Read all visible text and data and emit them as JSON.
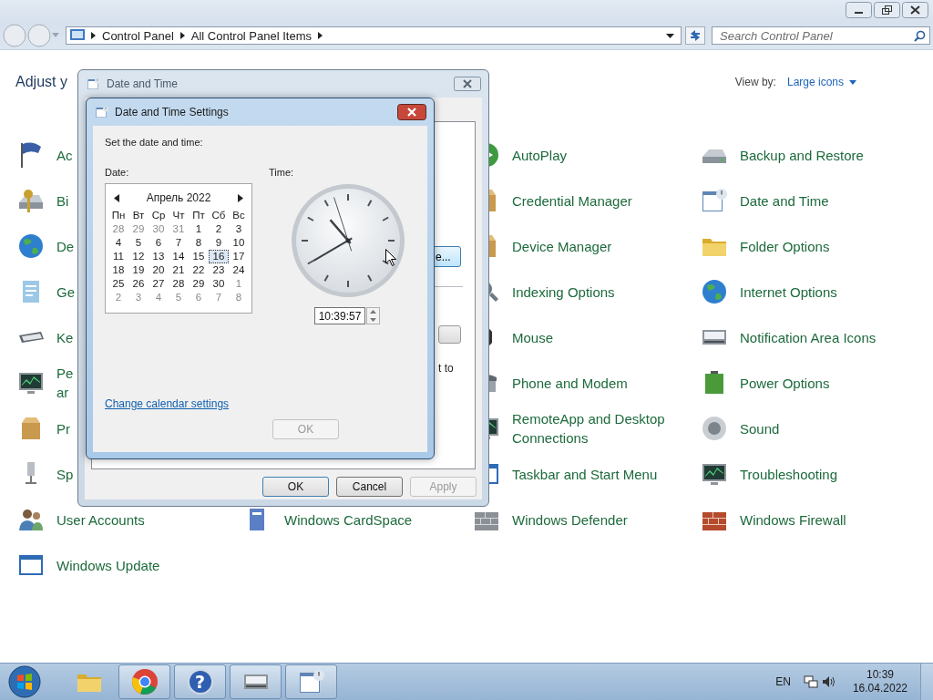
{
  "address_bar": {
    "crumbs": [
      "Control Panel",
      "All Control Panel Items"
    ]
  },
  "search": {
    "placeholder": "Search Control Panel"
  },
  "content": {
    "heading": "Adjust y",
    "view_by_label": "View by:",
    "view_by_value": "Large icons",
    "rows": [
      {
        "items": [
          {
            "kind": "item",
            "label": "Ac"
          },
          {
            "kind": "covered"
          },
          {
            "kind": "item",
            "label": "AutoPlay"
          },
          {
            "kind": "item",
            "label": "Backup and Restore"
          }
        ]
      },
      {
        "items": [
          {
            "kind": "item",
            "label": "Bi"
          },
          {
            "kind": "covered"
          },
          {
            "kind": "item",
            "label": "Credential Manager"
          },
          {
            "kind": "item",
            "label": "Date and Time"
          }
        ]
      },
      {
        "items": [
          {
            "kind": "item",
            "label": "De"
          },
          {
            "kind": "covered"
          },
          {
            "kind": "item",
            "label": "Device Manager"
          },
          {
            "kind": "item",
            "label": "Folder Options"
          }
        ]
      },
      {
        "items": [
          {
            "kind": "item",
            "label": "Ge"
          },
          {
            "kind": "covered"
          },
          {
            "kind": "item",
            "label": "Indexing Options"
          },
          {
            "kind": "item",
            "label": "Internet Options"
          }
        ]
      },
      {
        "items": [
          {
            "kind": "item",
            "label": "Ke"
          },
          {
            "kind": "covered"
          },
          {
            "kind": "item",
            "label": "Mouse"
          },
          {
            "kind": "item",
            "label": "Notification Area Icons"
          }
        ]
      },
      {
        "items": [
          {
            "kind": "item",
            "lines": [
              "Pe",
              "ar"
            ]
          },
          {
            "kind": "covered"
          },
          {
            "kind": "item",
            "label": "Phone and Modem"
          },
          {
            "kind": "item",
            "label": "Power Options"
          }
        ]
      },
      {
        "items": [
          {
            "kind": "item",
            "label": "Pr"
          },
          {
            "kind": "covered"
          },
          {
            "kind": "item",
            "label": "RemoteApp and Desktop Connections"
          },
          {
            "kind": "item",
            "label": "Sound"
          }
        ]
      },
      {
        "items": [
          {
            "kind": "item",
            "label": "Sp"
          },
          {
            "kind": "covered"
          },
          {
            "kind": "item",
            "label": "Taskbar and Start Menu"
          },
          {
            "kind": "item",
            "label": "Troubleshooting"
          }
        ]
      },
      {
        "items": [
          {
            "kind": "item",
            "label": "User Accounts"
          },
          {
            "kind": "item",
            "label": "Windows CardSpace"
          },
          {
            "kind": "item",
            "label": "Windows Defender"
          },
          {
            "kind": "item",
            "label": "Windows Firewall"
          }
        ]
      },
      {
        "items": [
          {
            "kind": "item",
            "label": "Windows Update"
          }
        ]
      }
    ]
  },
  "date_time_dialog": {
    "title": "Date and Time",
    "change_button_text": "e...",
    "note_text": "t to",
    "buttons": [
      {
        "label": "OK",
        "disabled": false
      },
      {
        "label": "Cancel",
        "disabled": false
      },
      {
        "label": "Apply",
        "disabled": true
      }
    ]
  },
  "settings_dialog": {
    "title": "Date and Time Settings",
    "prompt": "Set the date and time:",
    "date_label": "Date:",
    "time_label": "Time:",
    "calendar": {
      "month": "Апрель 2022",
      "weekdays": [
        "Пн",
        "Вт",
        "Ср",
        "Чт",
        "Пт",
        "Сб",
        "Вс"
      ],
      "weeks": [
        [
          {
            "day": "28",
            "other_month": true,
            "selected": false
          },
          {
            "day": "29",
            "other_month": true,
            "selected": false
          },
          {
            "day": "30",
            "other_month": true,
            "selected": false
          },
          {
            "day": "31",
            "other_month": true,
            "selected": false
          },
          {
            "day": "1",
            "other_month": false,
            "selected": false
          },
          {
            "day": "2",
            "other_month": false,
            "selected": false
          },
          {
            "day": "3",
            "other_month": false,
            "selected": false
          }
        ],
        [
          {
            "day": "4",
            "other_month": false,
            "selected": false
          },
          {
            "day": "5",
            "other_month": false,
            "selected": false
          },
          {
            "day": "6",
            "other_month": false,
            "selected": false
          },
          {
            "day": "7",
            "other_month": false,
            "selected": false
          },
          {
            "day": "8",
            "other_month": false,
            "selected": false
          },
          {
            "day": "9",
            "other_month": false,
            "selected": false
          },
          {
            "day": "10",
            "other_month": false,
            "selected": false
          }
        ],
        [
          {
            "day": "11",
            "other_month": false,
            "selected": false
          },
          {
            "day": "12",
            "other_month": false,
            "selected": false
          },
          {
            "day": "13",
            "other_month": false,
            "selected": false
          },
          {
            "day": "14",
            "other_month": false,
            "selected": false
          },
          {
            "day": "15",
            "other_month": false,
            "selected": false
          },
          {
            "day": "16",
            "other_month": false,
            "selected": true
          },
          {
            "day": "17",
            "other_month": false,
            "selected": false
          }
        ],
        [
          {
            "day": "18",
            "other_month": false,
            "selected": false
          },
          {
            "day": "19",
            "other_month": false,
            "selected": false
          },
          {
            "day": "20",
            "other_month": false,
            "selected": false
          },
          {
            "day": "21",
            "other_month": false,
            "selected": false
          },
          {
            "day": "22",
            "other_month": false,
            "selected": false
          },
          {
            "day": "23",
            "other_month": false,
            "selected": false
          },
          {
            "day": "24",
            "other_month": false,
            "selected": false
          }
        ],
        [
          {
            "day": "25",
            "other_month": false,
            "selected": false
          },
          {
            "day": "26",
            "other_month": false,
            "selected": false
          },
          {
            "day": "27",
            "other_month": false,
            "selected": false
          },
          {
            "day": "28",
            "other_month": false,
            "selected": false
          },
          {
            "day": "29",
            "other_month": false,
            "selected": false
          },
          {
            "day": "30",
            "other_month": false,
            "selected": false
          },
          {
            "day": "1",
            "other_month": true,
            "selected": false
          }
        ],
        [
          {
            "day": "2",
            "other_month": true,
            "selected": false
          },
          {
            "day": "3",
            "other_month": true,
            "selected": false
          },
          {
            "day": "4",
            "other_month": true,
            "selected": false
          },
          {
            "day": "5",
            "other_month": true,
            "selected": false
          },
          {
            "day": "6",
            "other_month": true,
            "selected": false
          },
          {
            "day": "7",
            "other_month": true,
            "selected": false
          },
          {
            "day": "8",
            "other_month": true,
            "selected": false
          }
        ]
      ]
    },
    "time_value": "10:39:57",
    "link": "Change calendar settings",
    "ok_button": {
      "label": "OK",
      "disabled": true
    }
  },
  "taskbar": {
    "apps": [
      {
        "kind": "folder",
        "running": false
      },
      {
        "kind": "browser",
        "running": true
      },
      {
        "kind": "help",
        "running": true,
        "glyph": "?"
      },
      {
        "kind": "control-panel",
        "running": true
      },
      {
        "kind": "clock-calendar",
        "running": true
      }
    ],
    "language": "EN",
    "time": "10:39",
    "date": "16.04.2022"
  }
}
